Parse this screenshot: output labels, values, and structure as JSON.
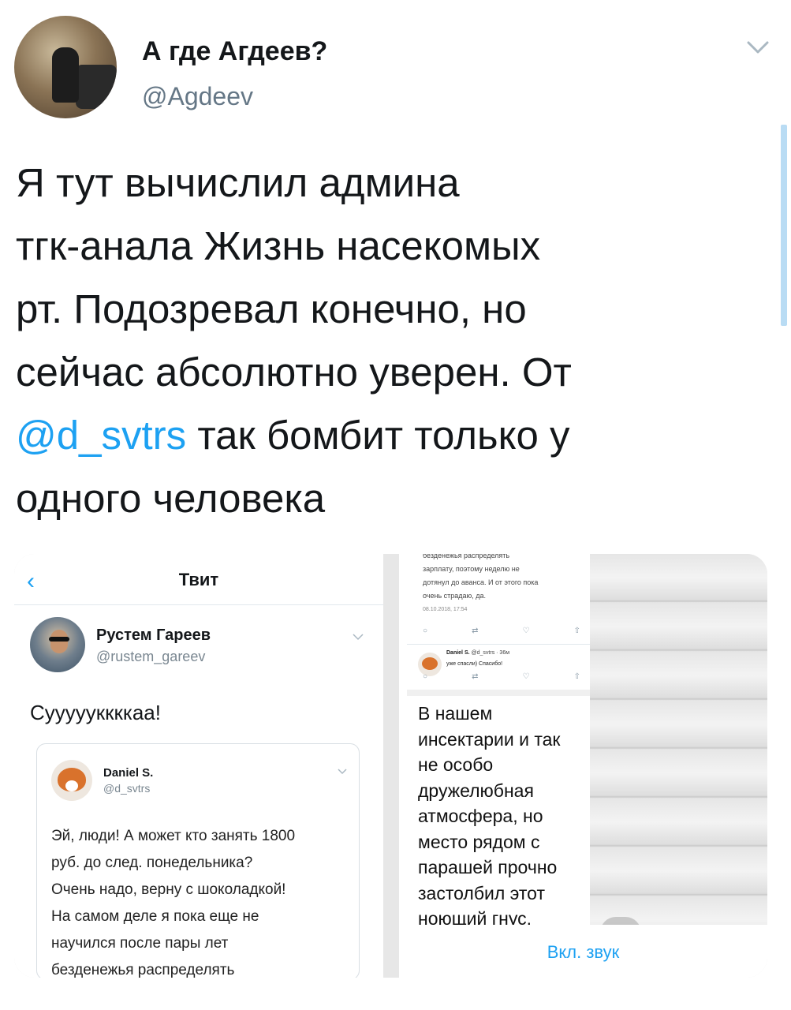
{
  "author": {
    "display_name": "А где Агдеев?",
    "handle": "@Agdeev"
  },
  "tweet": {
    "lines": [
      "Я тут вычислил админа",
      "тгк-анала Жизнь насекомых",
      "рт. Подозревал конечно, но",
      "сейчас абсолютно уверен. От"
    ],
    "mention": "@d_svtrs",
    "line5_rest": " так бомбит только у",
    "line6": "одного человека"
  },
  "colors": {
    "accent": "#1da1f2",
    "text": "#14171a",
    "muted": "#657786"
  },
  "left_screenshot": {
    "back_icon": "chevron-left-icon",
    "title": "Твит",
    "author_name": "Рустем Гареев",
    "author_handle": "@rustem_gareev",
    "text": "Суууууккккаа!",
    "quoted": {
      "name": "Daniel S.",
      "handle": "@d_svtrs",
      "lines": [
        "Эй, люди! А может кто занять 1800",
        "руб. до след. понедельника?",
        "Очень надо, верну с шоколадкой!",
        "На самом деле я пока еще не",
        "научился после пары лет",
        "безденежья распределять"
      ]
    }
  },
  "right_screenshot": {
    "top_lines": [
      "безденежья распределять",
      "зарплату, поэтому неделю не",
      "дотянул до аванса. И от этого пока",
      "очень страдаю, да."
    ],
    "top_date": "08.10.2018, 17:54",
    "reply_name": "Daniel S.",
    "reply_meta": "@d_svtrs · 36м",
    "reply_text": "уже спасли) Спасибо!",
    "overlay_lines": [
      "В нашем",
      "инсектарии и так",
      "не особо",
      "дружелюбная",
      "атмосфера, но",
      "место рядом с",
      "парашей прочно",
      "застолбил этот",
      "ноющий гнус."
    ],
    "sound_label": "Вкл. звук"
  }
}
